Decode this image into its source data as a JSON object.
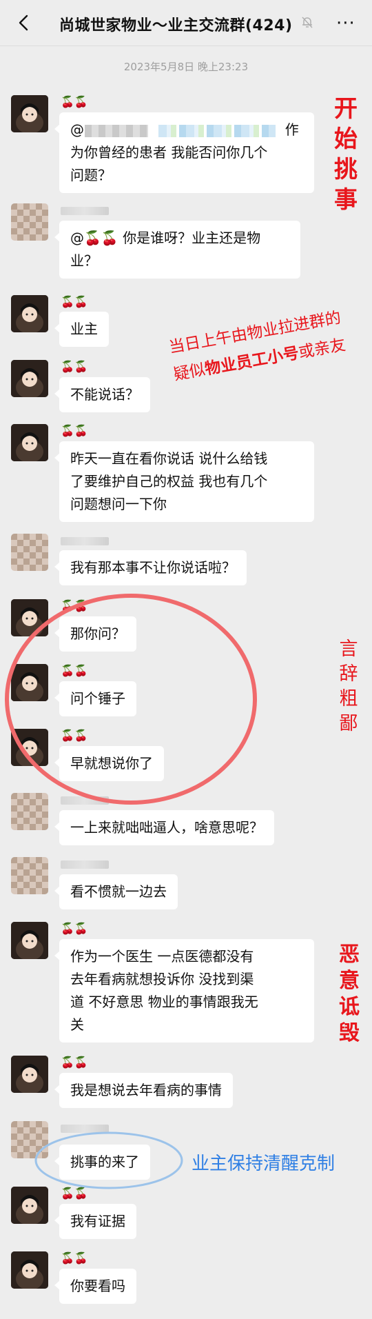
{
  "header": {
    "title": "尚城世家物业～业主交流群(424)",
    "back_icon": "chevron-left-icon",
    "mute_icon": "bell-muted-icon",
    "more_label": "···"
  },
  "timestamp": "2023年5月8日 晚上23:23",
  "emoji_nick": "🍒🍒",
  "messages": [
    {
      "line1_prefix": "@",
      "line1_suffix": "作",
      "line2": "为你曾经的患者   我能否问你几个",
      "line3": "问题？"
    },
    {
      "line1": "@🍒🍒 你是谁呀？业主还是物",
      "line2": "业？"
    },
    {
      "line1": "业主"
    },
    {
      "line1": "不能说话？"
    },
    {
      "line1": "昨天一直在看你说话   说什么给钱",
      "line2": "了要维护自己的权益   我也有几个",
      "line3": "问题想问一下你"
    },
    {
      "line1": "我有那本事不让你说话啦？"
    },
    {
      "line1": "那你问？"
    },
    {
      "line1": "问个锤子"
    },
    {
      "line1": "早就想说你了"
    },
    {
      "line1": "一上来就咄咄逼人，啥意思呢？"
    },
    {
      "line1": "看不惯就一边去"
    },
    {
      "line1": "作为一个医生   一点医德都没有",
      "line2": "去年看病就想投诉你   没找到渠",
      "line3": "道   不好意思   物业的事情跟我无",
      "line4": "关"
    },
    {
      "line1": "我是想说去年看病的事情"
    },
    {
      "line1": "挑事的来了"
    },
    {
      "line1": "我有证据"
    },
    {
      "line1": "你要看吗"
    }
  ],
  "annotations": {
    "start_trouble": [
      "开",
      "始",
      "挑",
      "事"
    ],
    "suspect_line1": "当日上午由物业拉进群的",
    "suspect_line2_pre": "疑似",
    "suspect_line2_bold": "物业员工小号",
    "suspect_line2_post": "或亲友",
    "crude": [
      "言",
      "辞",
      "粗",
      "鄙"
    ],
    "slander": [
      "恶",
      "意",
      "诋",
      "毁"
    ],
    "calm": "业主保持清醒克制"
  },
  "colors": {
    "background": "#ededed",
    "bubble": "#ffffff",
    "annotation_red": "#e8161c",
    "annotation_blue": "#2f7fe4",
    "circle_red": "#f06a6c",
    "circle_blue": "#9cc3ea"
  }
}
